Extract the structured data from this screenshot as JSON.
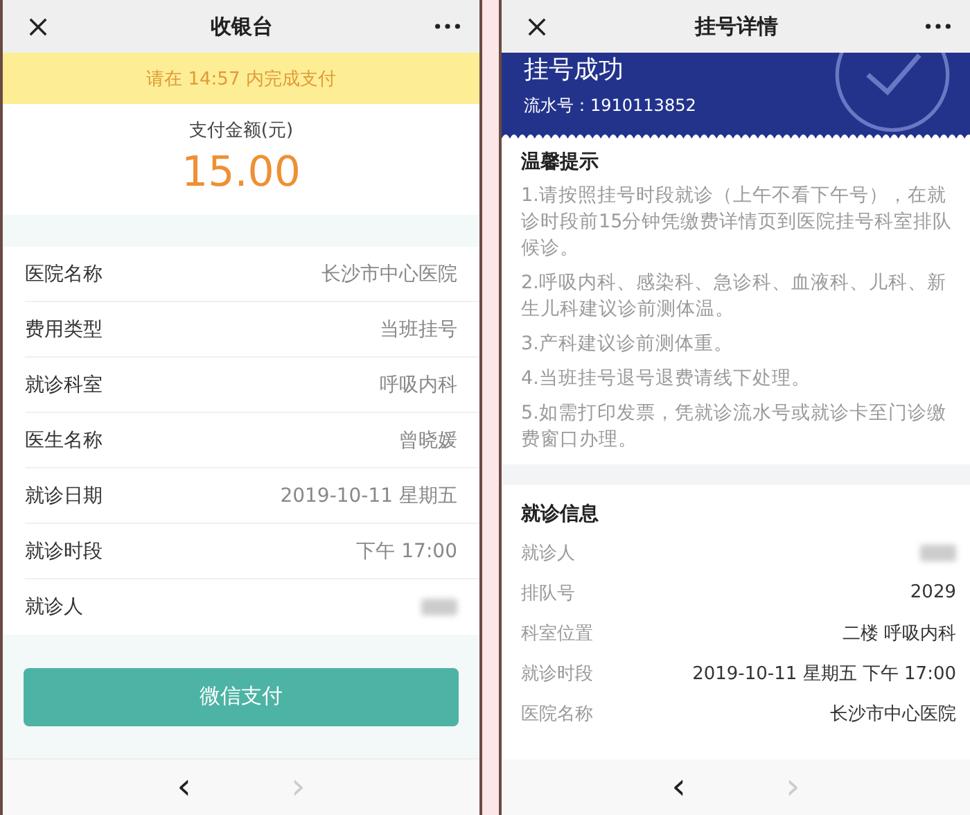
{
  "cashier": {
    "title": "收银台",
    "countdown": "请在 14:57 内完成支付",
    "amount_label": "支付金额(元)",
    "amount": "15.00",
    "rows": [
      {
        "label": "医院名称",
        "value": "长沙市中心医院",
        "kind": "text"
      },
      {
        "label": "费用类型",
        "value": "当班挂号",
        "kind": "text"
      },
      {
        "label": "就诊科室",
        "value": "呼吸内科",
        "kind": "text"
      },
      {
        "label": "医生名称",
        "value": "曾晓媛",
        "kind": "text"
      },
      {
        "label": "就诊日期",
        "value": "2019-10-11 星期五",
        "kind": "text"
      },
      {
        "label": "就诊时段",
        "value": "下午 17:00",
        "kind": "text"
      },
      {
        "label": "就诊人",
        "kind": "blurred"
      }
    ],
    "pay_button": "微信支付",
    "nav": [
      {
        "glyph": "‹",
        "disabled": false
      },
      {
        "glyph": "›",
        "disabled": true
      }
    ]
  },
  "detail": {
    "title": "挂号详情",
    "status": "挂号成功",
    "serial": "流水号：1910113852",
    "tips_title": "温馨提示",
    "tips": [
      "1.请按照挂号时段就诊（上午不看下午号），在就诊时段前15分钟凭缴费详情页到医院挂号科室排队候诊。",
      "2.呼吸内科、感染科、急诊科、血液科、儿科、新生儿科建议诊前测体温。",
      "3.产科建议诊前测体重。",
      "4.当班挂号退号退费请线下处理。",
      "5.如需打印发票，凭就诊流水号或就诊卡至门诊缴费窗口办理。"
    ],
    "info_title": "就诊信息",
    "rows": [
      {
        "label": "就诊人",
        "kind": "blurred"
      },
      {
        "label": "排队号",
        "value": "2029",
        "kind": "text"
      },
      {
        "label": "科室位置",
        "value": "二楼 呼吸内科",
        "kind": "text"
      },
      {
        "label": "就诊时段",
        "value": "2019-10-11 星期五 下午 17:00",
        "kind": "text"
      },
      {
        "label": "医院名称",
        "value": "长沙市中心医院",
        "kind": "text"
      }
    ],
    "nav": [
      {
        "glyph": "‹",
        "disabled": false
      },
      {
        "glyph": "›",
        "disabled": true
      }
    ]
  }
}
